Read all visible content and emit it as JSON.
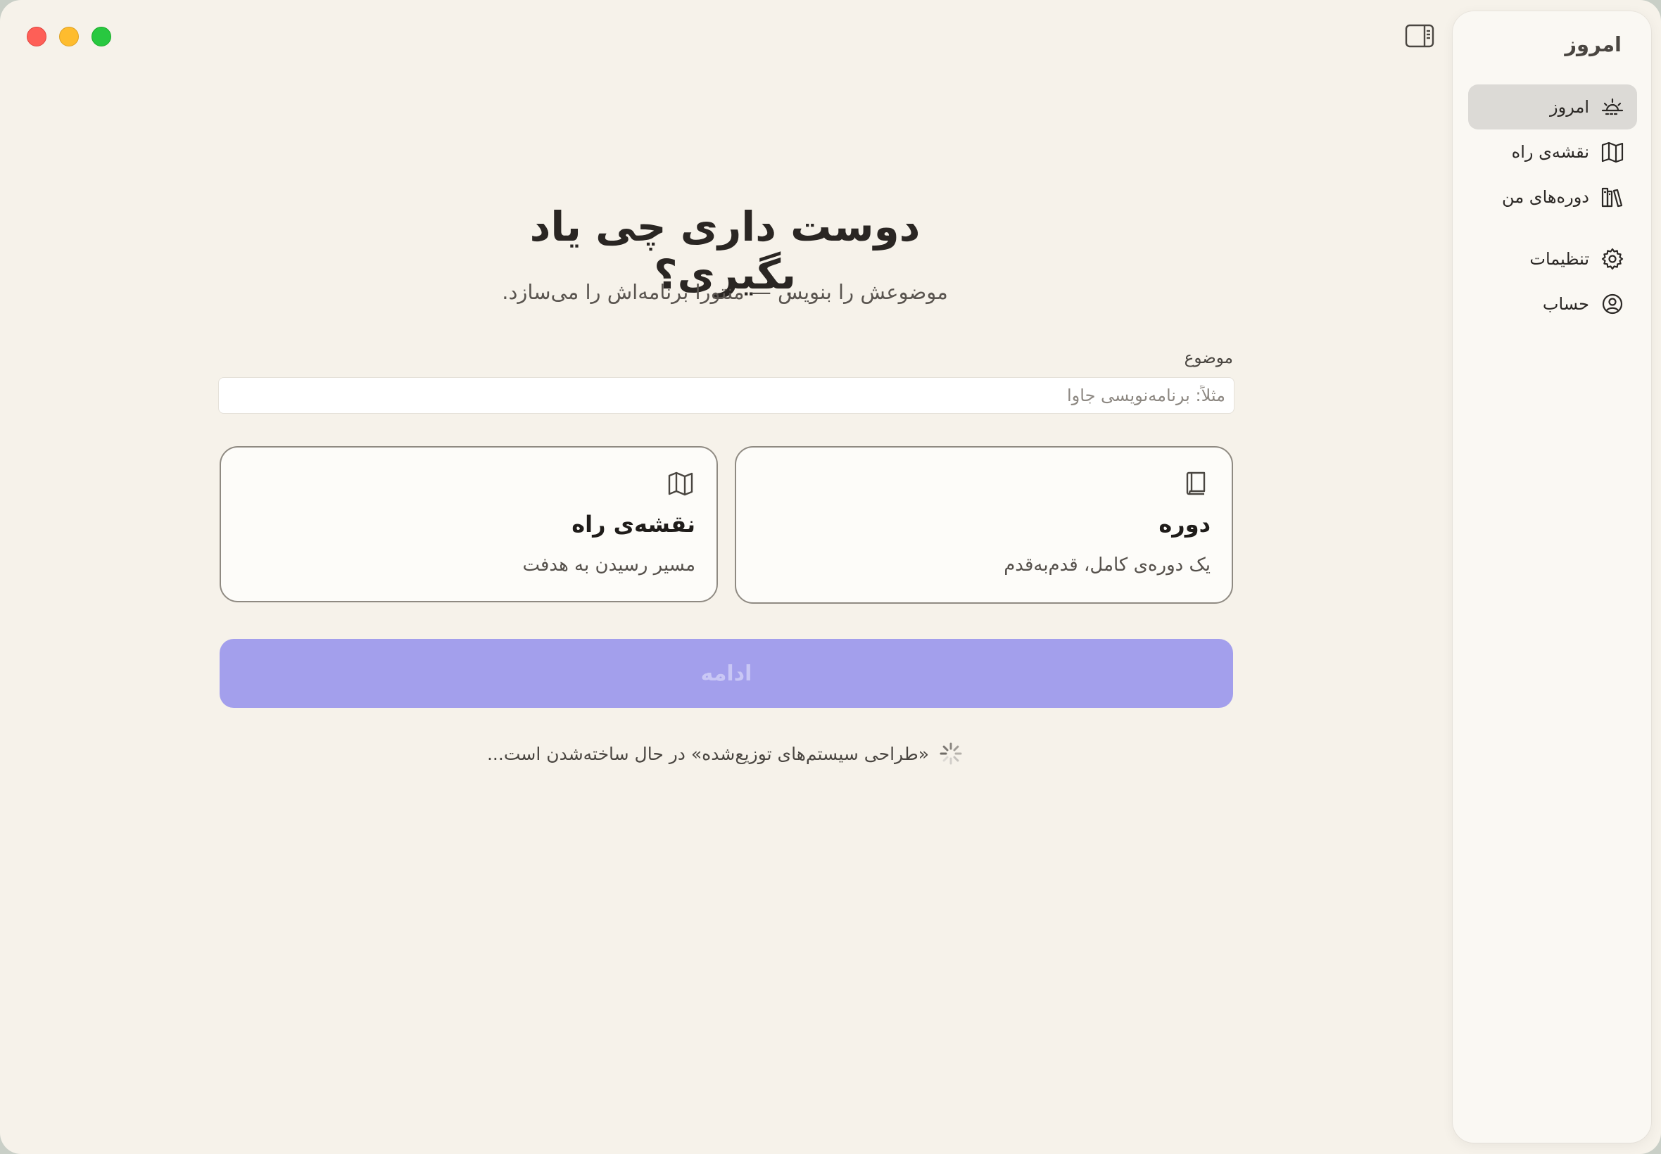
{
  "window": {
    "controls": [
      "close",
      "minimize",
      "maximize"
    ]
  },
  "sidebar": {
    "title": "امروز",
    "items": [
      {
        "label": "امروز",
        "icon": "sunrise-icon",
        "active": true
      },
      {
        "label": "نقشه‌ی راه",
        "icon": "map-icon",
        "active": false
      },
      {
        "label": "دوره‌های من",
        "icon": "library-icon",
        "active": false
      },
      {
        "label": "تنظیمات",
        "icon": "gear-icon",
        "active": false
      },
      {
        "label": "حساب",
        "icon": "user-circle-icon",
        "active": false
      }
    ]
  },
  "main": {
    "headline": "دوست داری چی یاد بگیری؟",
    "subtitle": "موضوعش را بنویس — منتورا برنامه‌اش را می‌سازد.",
    "topic": {
      "label": "موضوع",
      "placeholder": "مثلاً: برنامه‌نویسی جاوا",
      "value": ""
    },
    "options": [
      {
        "title": "دوره",
        "description": "یک دوره‌ی کامل، قدم‌به‌قدم",
        "icon": "book-icon"
      },
      {
        "title": "نقشه‌ی راه",
        "description": "مسیر رسیدن به هدفت",
        "icon": "map-icon"
      }
    ],
    "continue_label": "ادامه",
    "status_text": "«طراحی سیستم‌های توزیع‌شده» در حال ساخته‌شدن است..."
  },
  "colors": {
    "background": "#f6f2ea",
    "accent_disabled": "#a39fec",
    "active_nav": "#dcdad6"
  }
}
